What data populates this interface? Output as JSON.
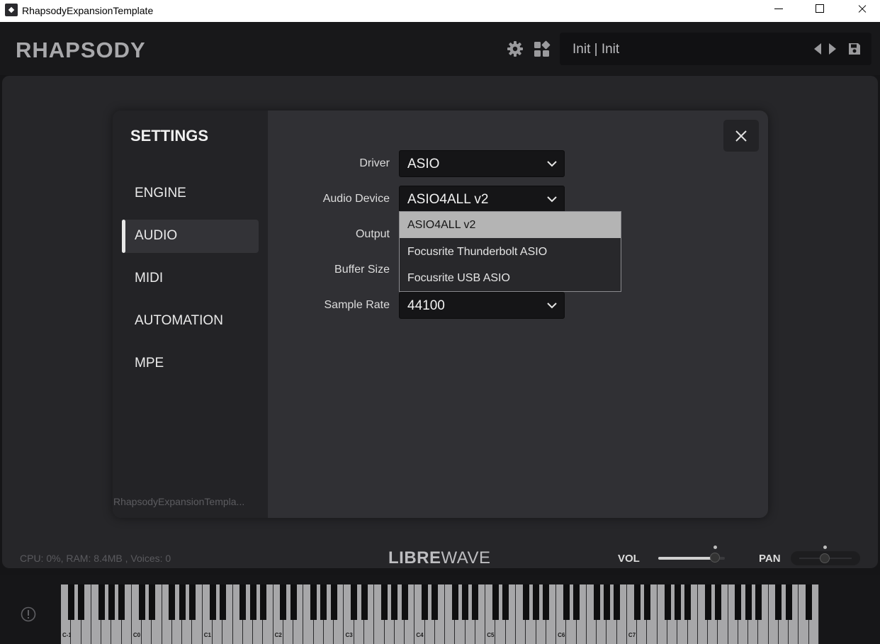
{
  "window": {
    "title": "RhapsodyExpansionTemplate"
  },
  "header": {
    "brand": "RHAPSODY",
    "preset_name": "Init | Init",
    "icons": [
      "gear-icon",
      "grid-icon",
      "prev-icon",
      "next-icon",
      "save-icon"
    ]
  },
  "settings": {
    "title": "SETTINGS",
    "nav": [
      {
        "label": "ENGINE",
        "active": false
      },
      {
        "label": "AUDIO",
        "active": true
      },
      {
        "label": "MIDI",
        "active": false
      },
      {
        "label": "AUTOMATION",
        "active": false
      },
      {
        "label": "MPE",
        "active": false
      }
    ],
    "instance_name": "RhapsodyExpansionTempla...",
    "fields": {
      "driver": {
        "label": "Driver",
        "value": "ASIO"
      },
      "audio_device": {
        "label": "Audio Device",
        "value": "ASIO4ALL v2"
      },
      "output": {
        "label": "Output"
      },
      "buffer_size": {
        "label": "Buffer Size"
      },
      "sample_rate": {
        "label": "Sample Rate",
        "value": "44100"
      }
    },
    "device_dropdown": {
      "options": [
        "ASIO4ALL v2",
        "Focusrite Thunderbolt ASIO",
        "Focusrite USB ASIO"
      ],
      "selected_index": 0
    }
  },
  "status": {
    "stats": "CPU: 0%, RAM: 8.4MB , Voices: 0",
    "logo_bold": "LIBRE",
    "logo_light": "WAVE",
    "vol_label": "VOL",
    "pan_label": "PAN",
    "vol_level": 0.85,
    "pan_level": 0.5
  },
  "keyboard": {
    "octave_labels": [
      "C-1",
      "C0",
      "C1",
      "C2",
      "C3",
      "C4",
      "C5",
      "C6",
      "C7"
    ]
  },
  "colors": {
    "background": "#151517",
    "panel": "#262629",
    "dialog": "#303034",
    "sidebar": "#232326",
    "selected_option": "#b4b4b4"
  }
}
